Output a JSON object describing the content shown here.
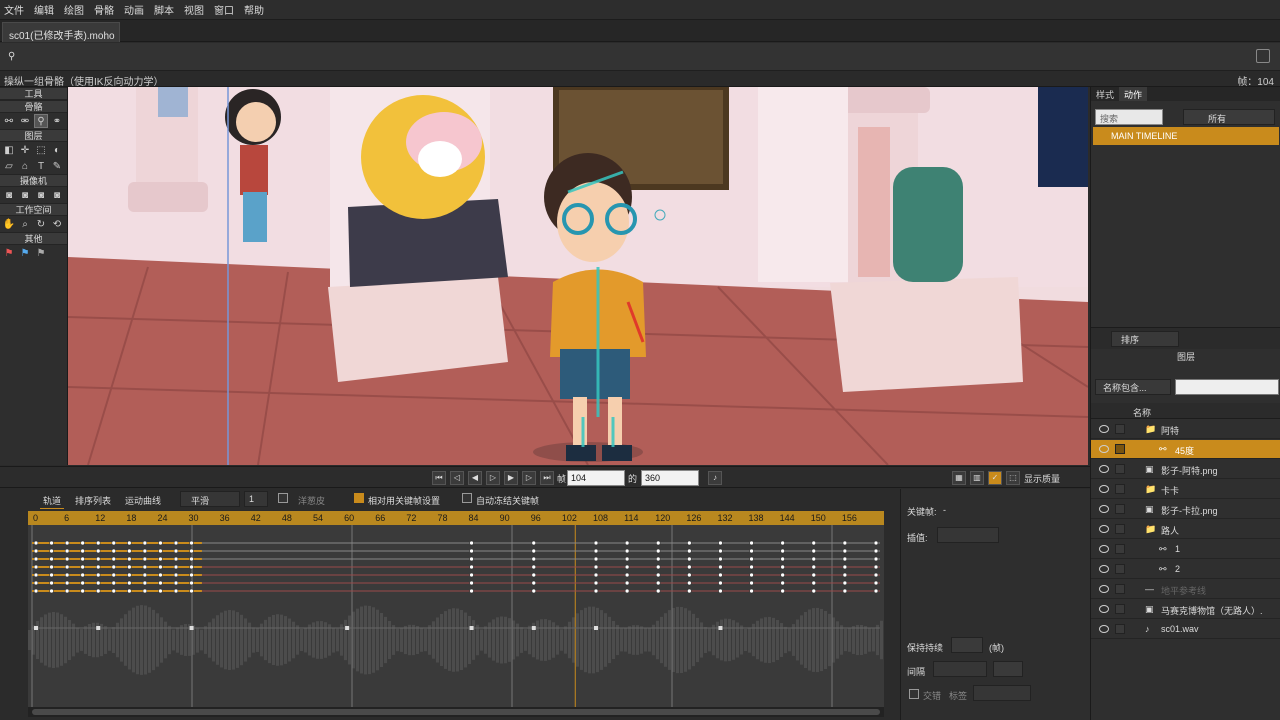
{
  "menu": [
    "文件",
    "编辑",
    "绘图",
    "骨骼",
    "动画",
    "脚本",
    "视图",
    "窗口",
    "帮助"
  ],
  "document_tab": "sc01(已修改手表).moho",
  "status": {
    "hint": "操纵一组骨骼（使用IK反向动力学）",
    "frame_label": "帧：104"
  },
  "toolbox": {
    "title": "工具",
    "sections": [
      "骨骼",
      "图层",
      "摄像机",
      "工作空间",
      "其他"
    ]
  },
  "right_panel": {
    "tabs": [
      "样式",
      "动作"
    ],
    "search_placeholder": "搜索",
    "filter": "所有",
    "main_timeline": "MAIN TIMELINE",
    "sort_label": "排序",
    "layers_title": "图层",
    "name_filter": "名称包含...",
    "name_header": "名称",
    "layers": [
      {
        "label": "阿特",
        "indent": 1,
        "type": "folder",
        "selected": false
      },
      {
        "label": "45度",
        "indent": 2,
        "type": "bone",
        "selected": true
      },
      {
        "label": "影子-阿特.png",
        "indent": 1,
        "type": "image",
        "selected": false
      },
      {
        "label": "卡卡",
        "indent": 1,
        "type": "folder-collapsed",
        "selected": false
      },
      {
        "label": "影子-卡拉.png",
        "indent": 1,
        "type": "image",
        "selected": false
      },
      {
        "label": "路人",
        "indent": 1,
        "type": "folder",
        "selected": false
      },
      {
        "label": "1",
        "indent": 2,
        "type": "bone",
        "selected": false
      },
      {
        "label": "2",
        "indent": 2,
        "type": "bone",
        "selected": false
      },
      {
        "label": "地平参考线",
        "indent": 1,
        "type": "hidden",
        "selected": false
      },
      {
        "label": "马赛克博物馆（无路人）.",
        "indent": 1,
        "type": "image",
        "selected": false
      },
      {
        "label": "sc01.wav",
        "indent": 1,
        "type": "audio",
        "selected": false
      }
    ]
  },
  "playback": {
    "frame_label": "帧",
    "frame": "104",
    "of_label": "的",
    "total": "360",
    "quality_label": "显示质量"
  },
  "timeline": {
    "tabs": [
      "轨道",
      "排序列表",
      "运动曲线"
    ],
    "interp": "平滑",
    "interp_value": "1",
    "onion": "洋葱皮",
    "relative_keys": "相对用关键帧设置",
    "auto_freeze": "自动冻结关键帧",
    "ruler": [
      0,
      6,
      12,
      18,
      24,
      30,
      36,
      42,
      48,
      54,
      60,
      66,
      72,
      78,
      84,
      90,
      96,
      102,
      108,
      114,
      120,
      126,
      132,
      138,
      144,
      150,
      156
    ],
    "current_frame": 104
  },
  "properties": {
    "keyframe_label": "关键帧:",
    "keyframe_value": "-",
    "interp_label": "插值:",
    "hold_label": "保持持续",
    "hold_unit": "(帧)",
    "cycle_label": "间隔",
    "cycle_check": "交错",
    "tag_label": "标签"
  },
  "colors": {
    "accent": "#c98b1c",
    "ruler": "#b9881f",
    "track_bg": "#3a3a3a"
  }
}
